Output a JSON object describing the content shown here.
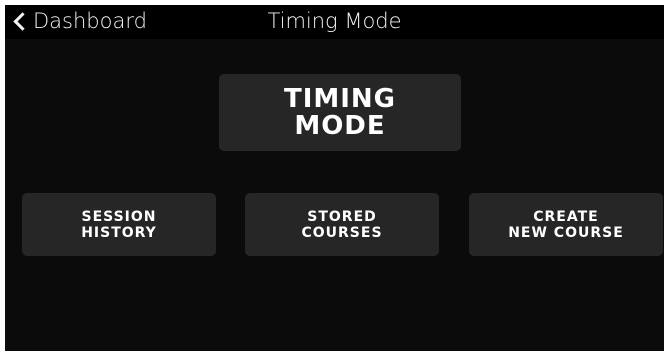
{
  "header": {
    "back_label": "Dashboard",
    "title": "Timing Mode",
    "back_icon": "chevron-left-icon"
  },
  "tiles": {
    "main": {
      "line1": "TIMING",
      "line2": "MODE"
    },
    "session_history": {
      "line1": "SESSION",
      "line2": "HISTORY"
    },
    "stored_courses": {
      "line1": "STORED",
      "line2": "COURSES"
    },
    "create_new_course": {
      "line1": "CREATE",
      "line2": "NEW COURSE"
    }
  },
  "colors": {
    "background": "#0b0b0b",
    "topbar": "#000000",
    "tile": "#262626",
    "text": "#ffffff"
  }
}
